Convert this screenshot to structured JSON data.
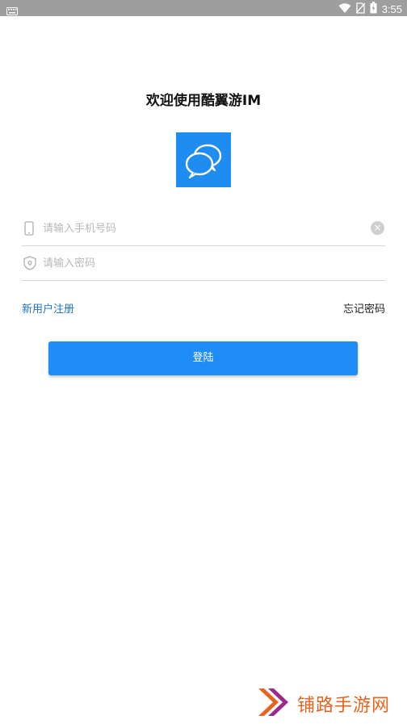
{
  "status_bar": {
    "time": "3:55",
    "icons": [
      "keyboard-icon",
      "wifi-icon",
      "no-sim-icon",
      "battery-icon"
    ]
  },
  "login": {
    "title": "欢迎使用酷翼游IM",
    "phone_placeholder": "请输入手机号码",
    "password_placeholder": "请输入密码",
    "clear_symbol": "×",
    "register_label": "新用户注册",
    "forgot_label": "忘记密码",
    "login_label": "登陆"
  },
  "watermark": {
    "text": "铺路手游网"
  },
  "colors": {
    "accent": "#1e8cf0",
    "link": "#1e73c8",
    "status_bar": "#9e9e9e",
    "watermark": "#e6641e"
  }
}
